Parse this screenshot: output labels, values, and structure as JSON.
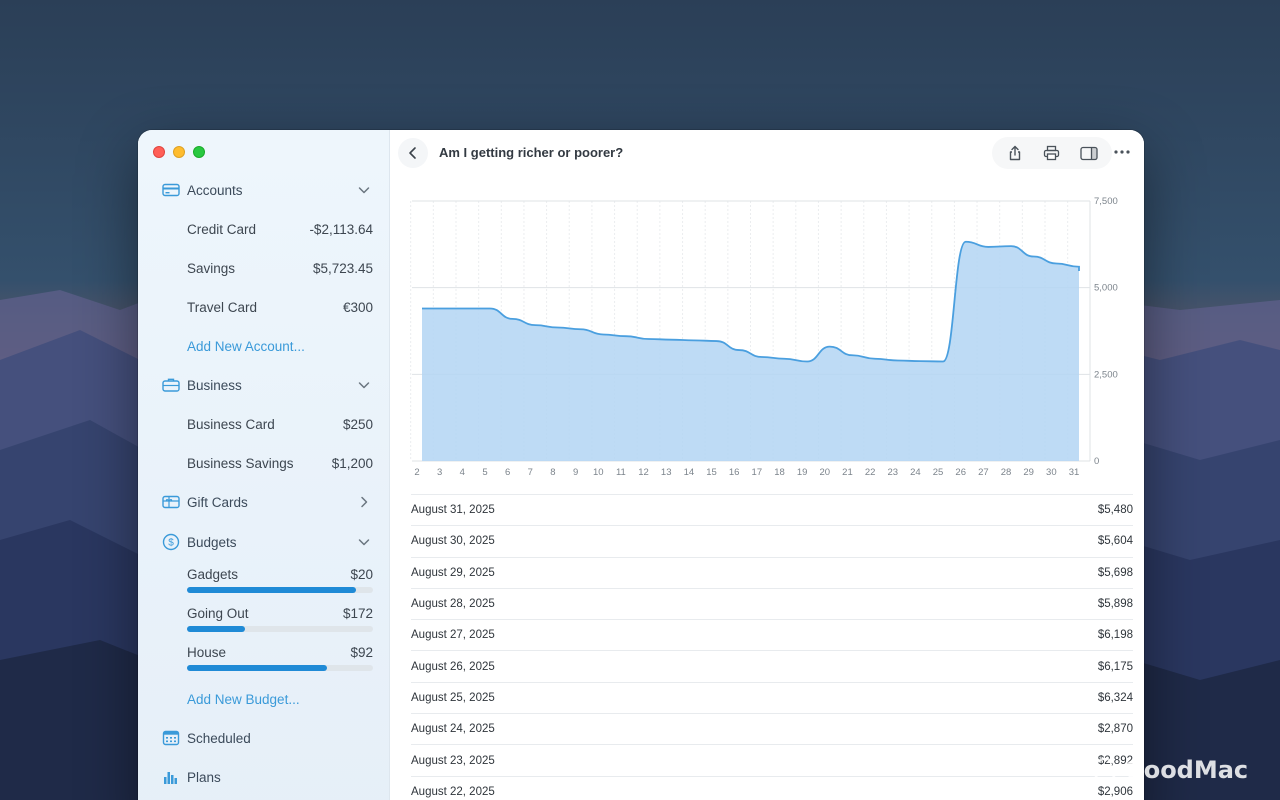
{
  "window": {
    "title": "Am I getting richer or poorer?"
  },
  "sidebar": {
    "accounts": {
      "label": "Accounts",
      "items": [
        {
          "label": "Credit Card",
          "amount": "-$2,113.64"
        },
        {
          "label": "Savings",
          "amount": "$5,723.45"
        },
        {
          "label": "Travel Card",
          "amount": "€300"
        }
      ],
      "add_label": "Add New Account..."
    },
    "business": {
      "label": "Business",
      "items": [
        {
          "label": "Business Card",
          "amount": "$250"
        },
        {
          "label": "Business Savings",
          "amount": "$1,200"
        }
      ]
    },
    "gift_cards": {
      "label": "Gift Cards"
    },
    "budgets": {
      "label": "Budgets",
      "items": [
        {
          "label": "Gadgets",
          "amount": "$20",
          "progress": 0.91
        },
        {
          "label": "Going Out",
          "amount": "$172",
          "progress": 0.31
        },
        {
          "label": "House",
          "amount": "$92",
          "progress": 0.75
        }
      ],
      "add_label": "Add New Budget..."
    },
    "scheduled": {
      "label": "Scheduled"
    },
    "plans": {
      "label": "Plans"
    }
  },
  "toolbar": {
    "icons": [
      "share-icon",
      "print-icon",
      "sidebar-toggle-icon",
      "more-icon"
    ]
  },
  "chart_data": {
    "type": "area",
    "x": [
      2,
      3,
      4,
      5,
      6,
      7,
      8,
      9,
      10,
      11,
      12,
      13,
      14,
      15,
      16,
      17,
      18,
      19,
      20,
      21,
      22,
      23,
      24,
      25,
      26,
      27,
      28,
      29,
      30,
      31
    ],
    "values": [
      4400,
      4400,
      4400,
      4400,
      4100,
      3920,
      3850,
      3800,
      3650,
      3600,
      3520,
      3500,
      3480,
      3460,
      3200,
      3000,
      2950,
      2870,
      3300,
      3050,
      2950,
      2900,
      2880,
      2870,
      6324,
      6175,
      6198,
      5898,
      5698,
      5604
    ],
    "final_value": 5480,
    "x_ticks": [
      "2",
      "3",
      "4",
      "5",
      "6",
      "7",
      "8",
      "9",
      "10",
      "11",
      "12",
      "13",
      "14",
      "15",
      "16",
      "17",
      "18",
      "19",
      "20",
      "21",
      "22",
      "23",
      "24",
      "25",
      "26",
      "27",
      "28",
      "29",
      "30",
      "31"
    ],
    "y_ticks": [
      "7,500",
      "5,000",
      "2,500",
      "0"
    ],
    "ylim": [
      0,
      7500
    ],
    "grid": true,
    "color": "#4a9fdf",
    "fill": "#b3d5f3"
  },
  "transactions": [
    {
      "date": "August 31, 2025",
      "value": "$5,480"
    },
    {
      "date": "August 30, 2025",
      "value": "$5,604"
    },
    {
      "date": "August 29, 2025",
      "value": "$5,698"
    },
    {
      "date": "August 28, 2025",
      "value": "$5,898"
    },
    {
      "date": "August 27, 2025",
      "value": "$6,198"
    },
    {
      "date": "August 26, 2025",
      "value": "$6,175"
    },
    {
      "date": "August 25, 2025",
      "value": "$6,324"
    },
    {
      "date": "August 24, 2025",
      "value": "$2,870"
    },
    {
      "date": "August 23, 2025",
      "value": "$2,892"
    },
    {
      "date": "August 22, 2025",
      "value": "$2,906"
    }
  ],
  "watermark": {
    "text": "GoodMac"
  }
}
